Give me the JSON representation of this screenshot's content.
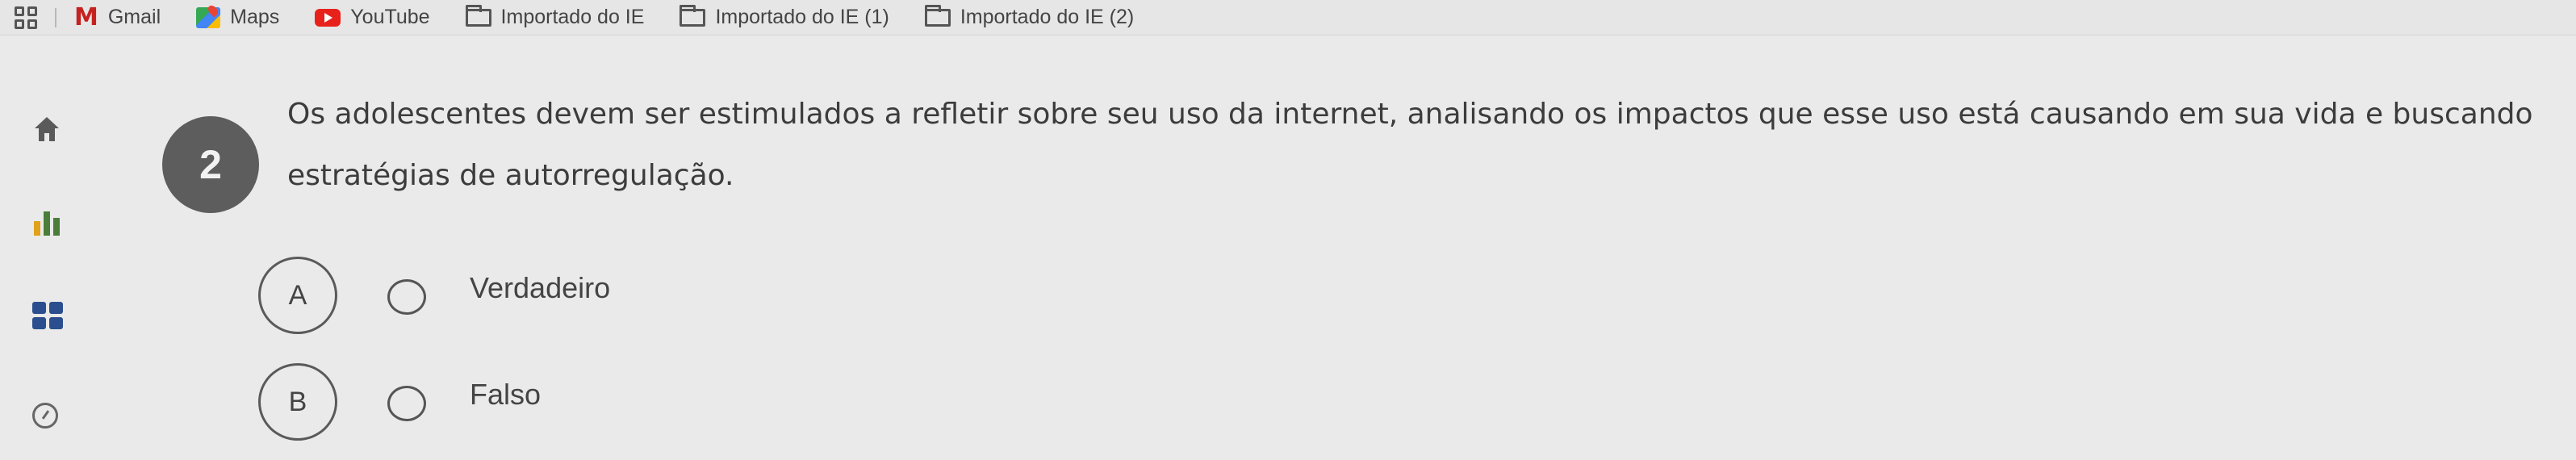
{
  "bookmarks": {
    "items": [
      {
        "label": "Gmail",
        "icon": "gmail-icon"
      },
      {
        "label": "Maps",
        "icon": "maps-icon"
      },
      {
        "label": "YouTube",
        "icon": "youtube-icon"
      },
      {
        "label": "Importado do IE",
        "icon": "folder-icon"
      },
      {
        "label": "Importado do IE (1)",
        "icon": "folder-icon"
      },
      {
        "label": "Importado do IE (2)",
        "icon": "folder-icon"
      }
    ]
  },
  "sidebar": {
    "icons": [
      "home-icon",
      "bar-chart-icon",
      "grid-icon",
      "gauge-icon"
    ]
  },
  "question": {
    "number": "2",
    "text": "Os adolescentes devem ser estimulados a refletir sobre seu uso da internet, analisando os impactos que esse uso está causando em sua vida e buscando estratégias de autorregulação."
  },
  "options": [
    {
      "letter": "A",
      "label": "Verdadeiro"
    },
    {
      "letter": "B",
      "label": "Falso"
    }
  ],
  "colors": {
    "background": "#eaeaea",
    "number_badge": "#5d5d5d",
    "youtube": "#e8211b",
    "gmail": "#c5221f",
    "grid_icon": "#2b4f8e"
  }
}
